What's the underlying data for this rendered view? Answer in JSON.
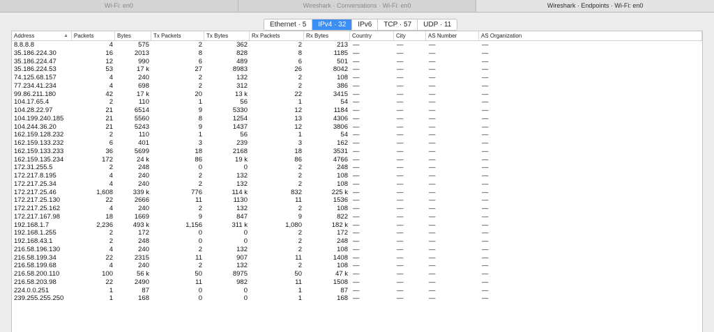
{
  "window_tabs": [
    {
      "label": "Wi-Fi: en0",
      "active": false
    },
    {
      "label": "Wireshark · Conversations · Wi-Fi: en0",
      "active": false
    },
    {
      "label": "Wireshark · Endpoints · Wi-Fi: en0",
      "active": true
    }
  ],
  "segments": [
    {
      "label": "Ethernet · 5",
      "active": false
    },
    {
      "label": "IPv4 · 32",
      "active": true
    },
    {
      "label": "IPv6",
      "active": false
    },
    {
      "label": "TCP · 57",
      "active": false
    },
    {
      "label": "UDP · 11",
      "active": false
    }
  ],
  "table": {
    "sort_indicator": "▲",
    "columns": [
      "Address",
      "Packets",
      "Bytes",
      "Tx Packets",
      "Tx Bytes",
      "Rx Packets",
      "Rx Bytes",
      "Country",
      "City",
      "AS Number",
      "AS Organization"
    ],
    "empty_value": "—",
    "rows": [
      [
        "8.8.8.8",
        "4",
        "575",
        "2",
        "362",
        "2",
        "213"
      ],
      [
        "35.186.224.30",
        "16",
        "2013",
        "8",
        "828",
        "8",
        "1185"
      ],
      [
        "35.186.224.47",
        "12",
        "990",
        "6",
        "489",
        "6",
        "501"
      ],
      [
        "35.186.224.53",
        "53",
        "17 k",
        "27",
        "8983",
        "26",
        "8042"
      ],
      [
        "74.125.68.157",
        "4",
        "240",
        "2",
        "132",
        "2",
        "108"
      ],
      [
        "77.234.41.234",
        "4",
        "698",
        "2",
        "312",
        "2",
        "386"
      ],
      [
        "99.86.211.180",
        "42",
        "17 k",
        "20",
        "13 k",
        "22",
        "3415"
      ],
      [
        "104.17.65.4",
        "2",
        "110",
        "1",
        "56",
        "1",
        "54"
      ],
      [
        "104.28.22.97",
        "21",
        "6514",
        "9",
        "5330",
        "12",
        "1184"
      ],
      [
        "104.199.240.185",
        "21",
        "5560",
        "8",
        "1254",
        "13",
        "4306"
      ],
      [
        "104.244.36.20",
        "21",
        "5243",
        "9",
        "1437",
        "12",
        "3806"
      ],
      [
        "162.159.128.232",
        "2",
        "110",
        "1",
        "56",
        "1",
        "54"
      ],
      [
        "162.159.133.232",
        "6",
        "401",
        "3",
        "239",
        "3",
        "162"
      ],
      [
        "162.159.133.233",
        "36",
        "5699",
        "18",
        "2168",
        "18",
        "3531"
      ],
      [
        "162.159.135.234",
        "172",
        "24 k",
        "86",
        "19 k",
        "86",
        "4766"
      ],
      [
        "172.31.255.5",
        "2",
        "248",
        "0",
        "0",
        "2",
        "248"
      ],
      [
        "172.217.8.195",
        "4",
        "240",
        "2",
        "132",
        "2",
        "108"
      ],
      [
        "172.217.25.34",
        "4",
        "240",
        "2",
        "132",
        "2",
        "108"
      ],
      [
        "172.217.25.46",
        "1,608",
        "339 k",
        "776",
        "114 k",
        "832",
        "225 k"
      ],
      [
        "172.217.25.130",
        "22",
        "2666",
        "11",
        "1130",
        "11",
        "1536"
      ],
      [
        "172.217.25.162",
        "4",
        "240",
        "2",
        "132",
        "2",
        "108"
      ],
      [
        "172.217.167.98",
        "18",
        "1669",
        "9",
        "847",
        "9",
        "822"
      ],
      [
        "192.168.1.7",
        "2,236",
        "493 k",
        "1,156",
        "311 k",
        "1,080",
        "182 k"
      ],
      [
        "192.168.1.255",
        "2",
        "172",
        "0",
        "0",
        "2",
        "172"
      ],
      [
        "192.168.43.1",
        "2",
        "248",
        "0",
        "0",
        "2",
        "248"
      ],
      [
        "216.58.196.130",
        "4",
        "240",
        "2",
        "132",
        "2",
        "108"
      ],
      [
        "216.58.199.34",
        "22",
        "2315",
        "11",
        "907",
        "11",
        "1408"
      ],
      [
        "216.58.199.68",
        "4",
        "240",
        "2",
        "132",
        "2",
        "108"
      ],
      [
        "216.58.200.110",
        "100",
        "56 k",
        "50",
        "8975",
        "50",
        "47 k"
      ],
      [
        "216.58.203.98",
        "22",
        "2490",
        "11",
        "982",
        "11",
        "1508"
      ],
      [
        "224.0.0.251",
        "1",
        "87",
        "0",
        "0",
        "1",
        "87"
      ],
      [
        "239.255.255.250",
        "1",
        "168",
        "0",
        "0",
        "1",
        "168"
      ]
    ]
  }
}
